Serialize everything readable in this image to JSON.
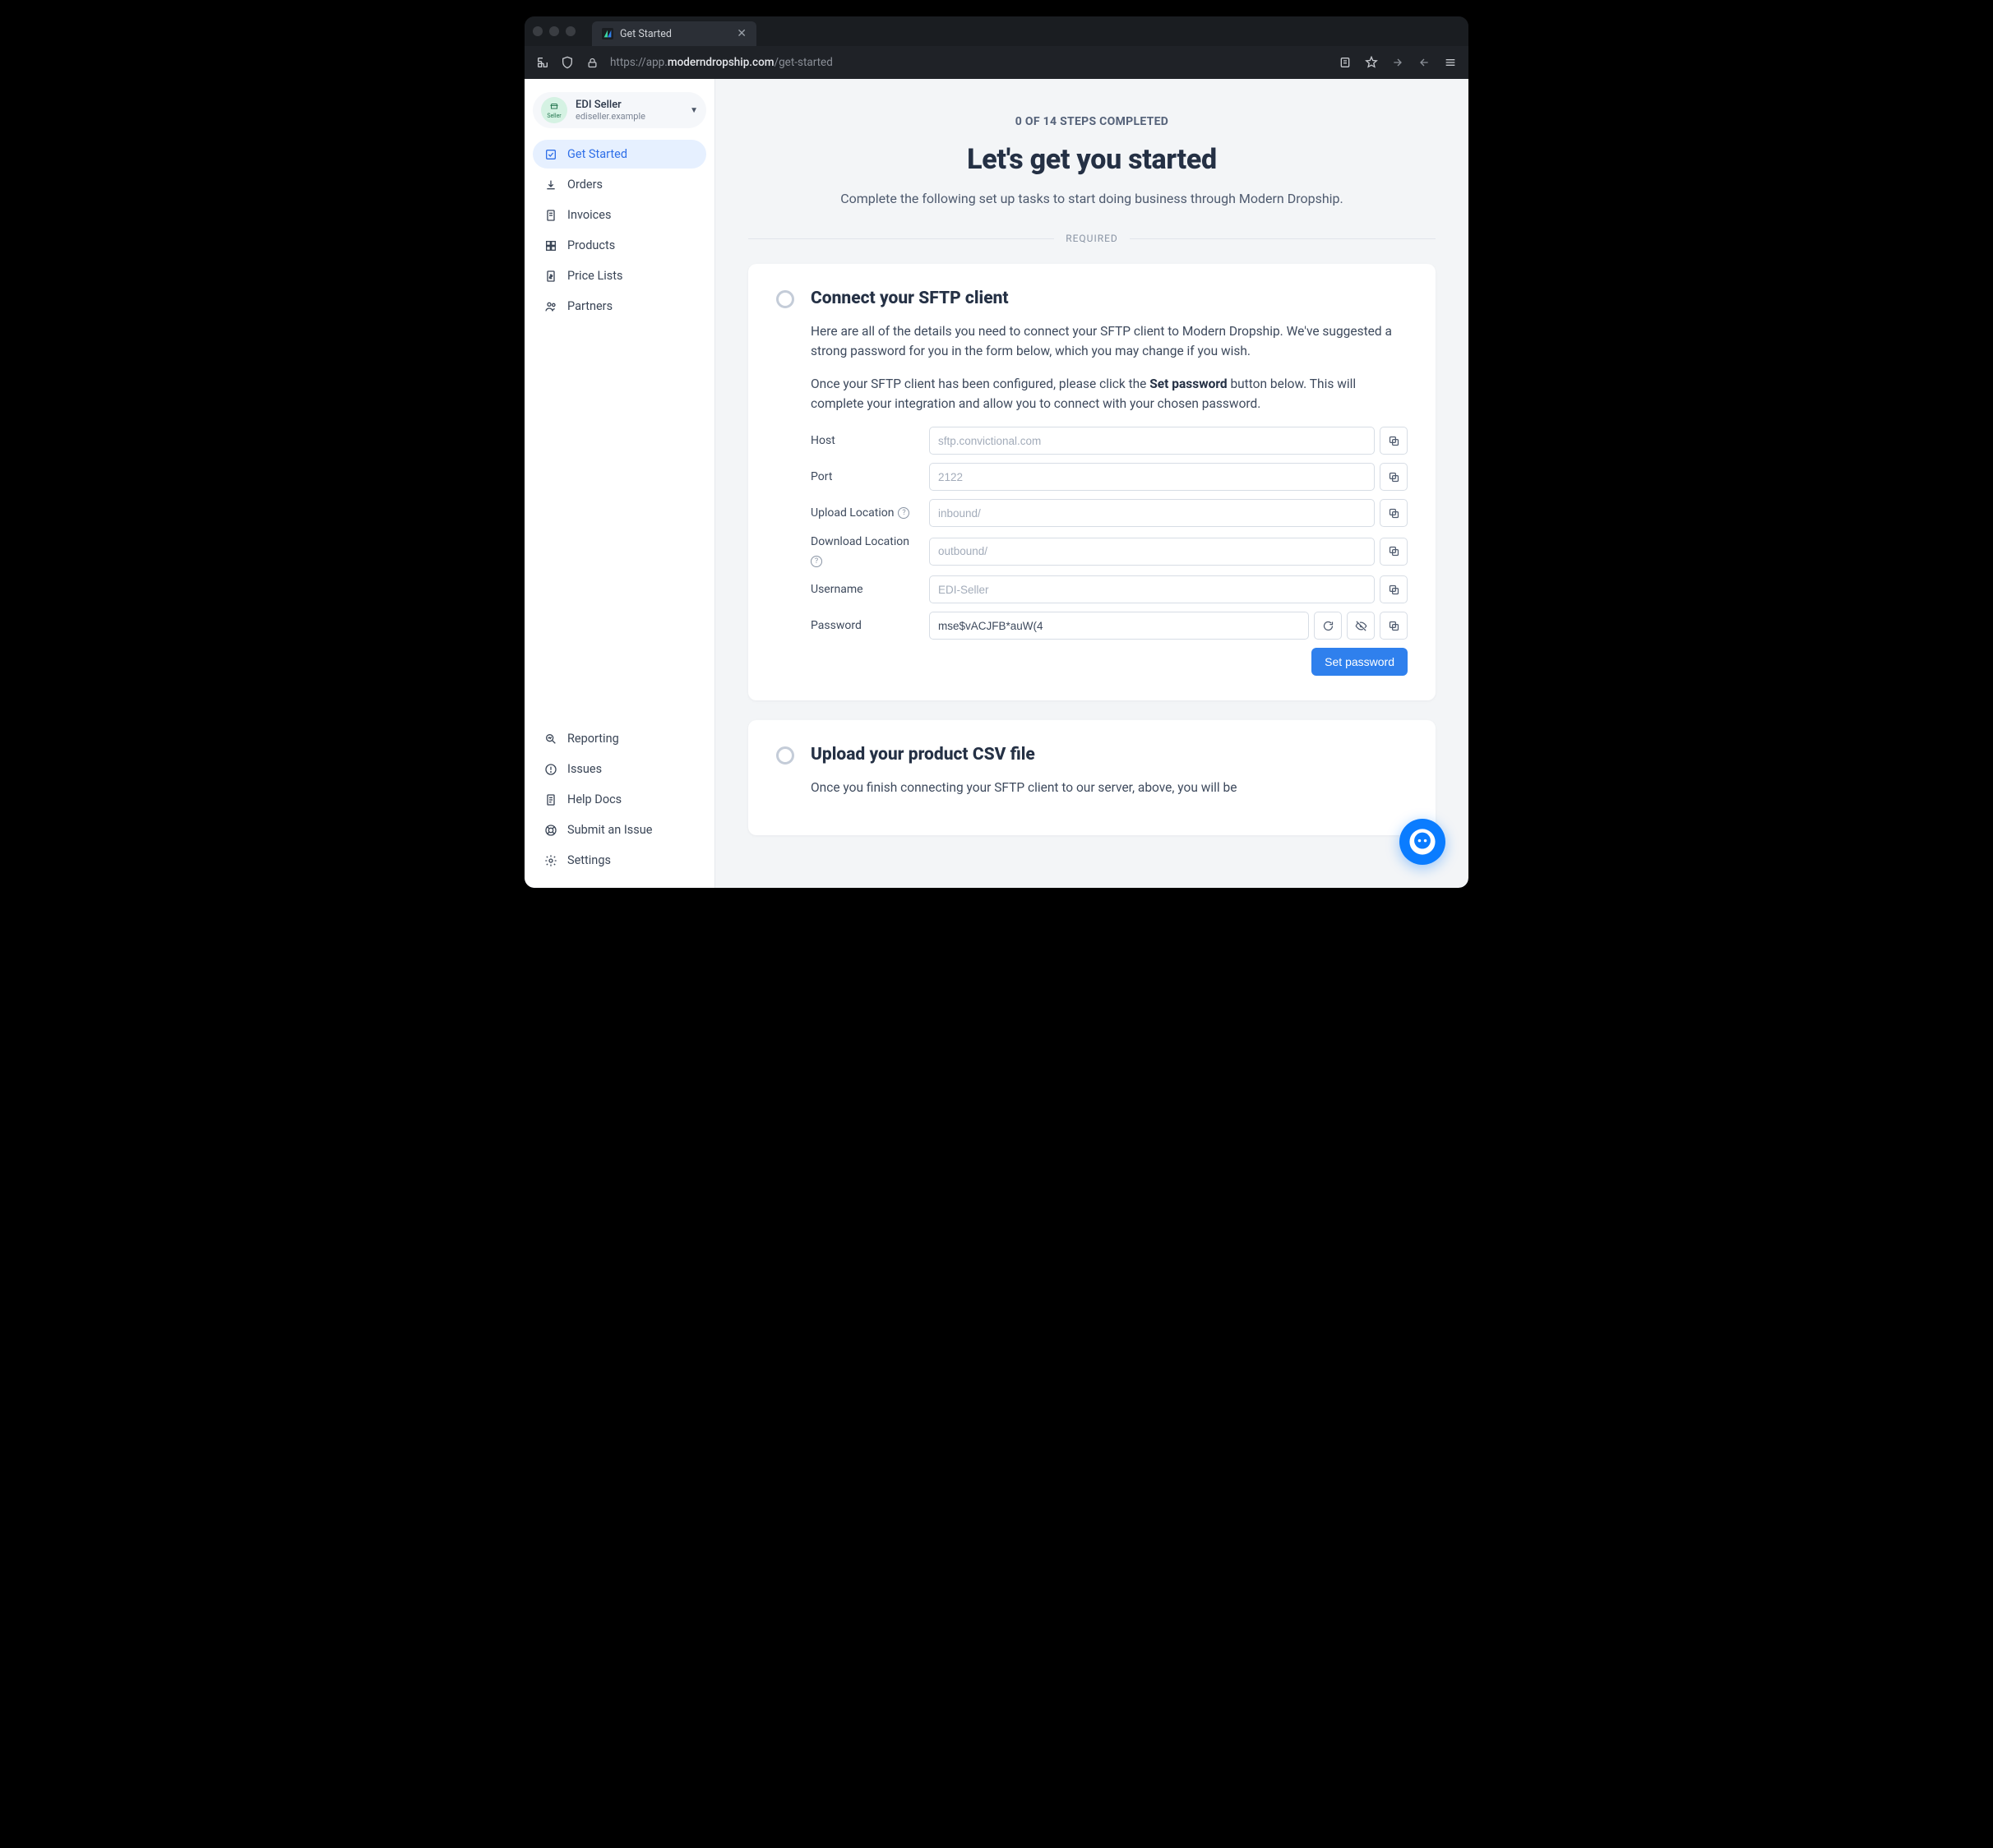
{
  "browser": {
    "tab_title": "Get Started",
    "url_prefix": "https://app.",
    "url_bold": "moderndropship.com",
    "url_path": "/get-started"
  },
  "account": {
    "badge_label": "Seller",
    "name": "EDI Seller",
    "sub": "ediseller.example"
  },
  "nav": {
    "get_started": "Get Started",
    "orders": "Orders",
    "invoices": "Invoices",
    "products": "Products",
    "price_lists": "Price Lists",
    "partners": "Partners",
    "reporting": "Reporting",
    "issues": "Issues",
    "help_docs": "Help Docs",
    "submit_issue": "Submit an Issue",
    "settings": "Settings"
  },
  "hero": {
    "progress": "0 OF 14 STEPS COMPLETED",
    "title": "Let's get you started",
    "subtitle": "Complete the following set up tasks to start doing business through Modern Dropship.",
    "required_label": "REQUIRED"
  },
  "sftp": {
    "title": "Connect your SFTP client",
    "p1": "Here are all of the details you need to connect your SFTP client to Modern Dropship. We've suggested a strong password for you in the form below, which you may change if you wish.",
    "p2a": "Once your SFTP client has been configured, please click the ",
    "p2b": "Set password",
    "p2c": " button below. This will complete your integration and allow you to connect with your chosen password.",
    "labels": {
      "host": "Host",
      "port": "Port",
      "upload": "Upload Location",
      "download": "Download Location",
      "username": "Username",
      "password": "Password"
    },
    "values": {
      "host": "sftp.convictional.com",
      "port": "2122",
      "upload": "inbound/",
      "download": "outbound/",
      "username": "EDI-Seller",
      "password": "mse$vACJFB*auW(4"
    },
    "set_password": "Set password"
  },
  "csv": {
    "title": "Upload your product CSV file",
    "p1": "Once you finish connecting your SFTP client to our server, above, you will be"
  }
}
